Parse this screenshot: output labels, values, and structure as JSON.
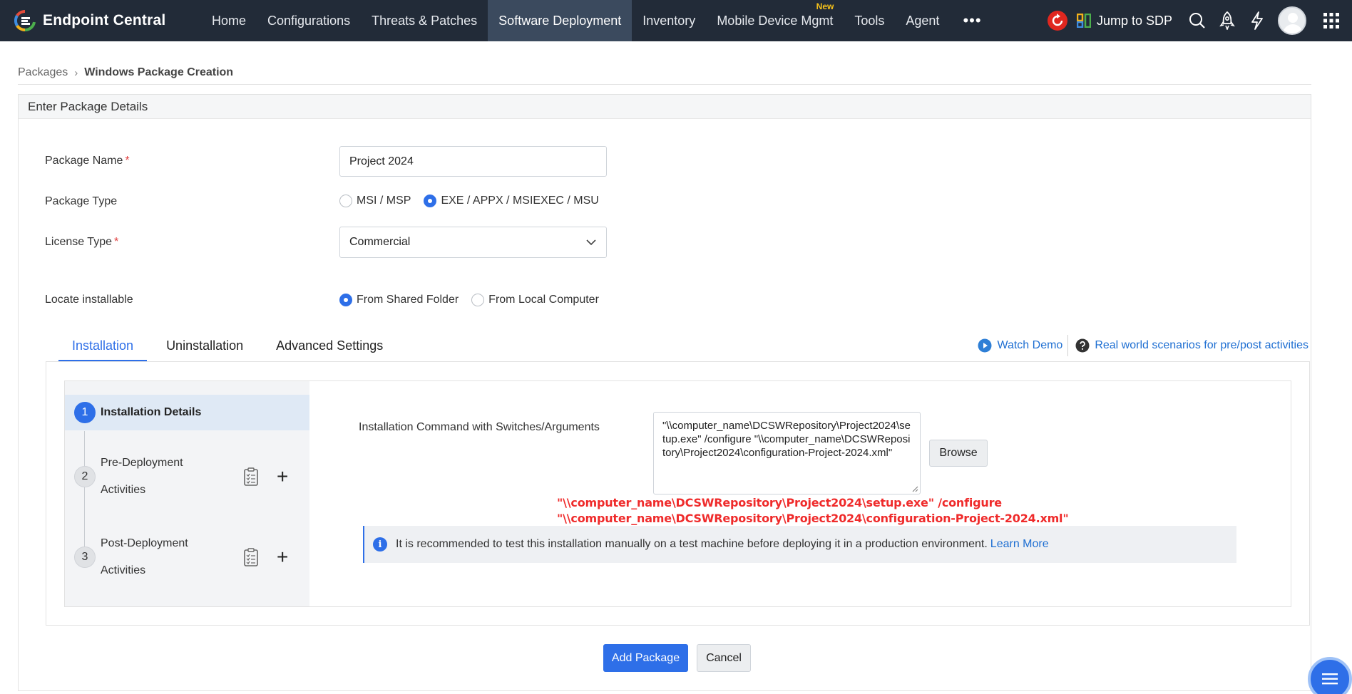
{
  "brand": {
    "name": "Endpoint Central"
  },
  "nav": {
    "items": [
      {
        "label": "Home"
      },
      {
        "label": "Configurations"
      },
      {
        "label": "Threats & Patches"
      },
      {
        "label": "Software Deployment"
      },
      {
        "label": "Inventory"
      },
      {
        "label": "Mobile Device Mgmt",
        "badge": "New"
      },
      {
        "label": "Tools"
      },
      {
        "label": "Agent"
      }
    ],
    "more_label": "•••",
    "active_index": 3,
    "jump_label": "Jump to SDP",
    "icons": [
      "refresh-icon",
      "sdp-icon",
      "search-icon",
      "rocket-icon",
      "lightning-icon",
      "avatar",
      "app-grid-icon"
    ]
  },
  "breadcrumb": {
    "parent": "Packages",
    "separator": "›",
    "current": "Windows Package Creation"
  },
  "panel": {
    "title": "Enter Package Details"
  },
  "form": {
    "package_name": {
      "label": "Package Name",
      "value": "Project 2024"
    },
    "package_type": {
      "label": "Package Type",
      "options": [
        {
          "label": "MSI / MSP",
          "selected": false
        },
        {
          "label": "EXE / APPX / MSIEXEC / MSU",
          "selected": true
        }
      ]
    },
    "license_type": {
      "label": "License Type",
      "value": "Commercial"
    },
    "locate": {
      "label": "Locate installable",
      "options": [
        {
          "label": "From Shared Folder",
          "selected": true
        },
        {
          "label": "From Local Computer",
          "selected": false
        }
      ]
    },
    "required_marker": "*"
  },
  "tabs": [
    {
      "label": "Installation",
      "active": true
    },
    {
      "label": "Uninstallation",
      "active": false
    },
    {
      "label": "Advanced Settings",
      "active": false
    }
  ],
  "help": {
    "watch_demo": "Watch Demo",
    "scenarios": "Real world scenarios for pre/post activities"
  },
  "steps": [
    {
      "num": "1",
      "label": "Installation Details"
    },
    {
      "num": "2",
      "label": "Pre-Deployment Activities"
    },
    {
      "num": "3",
      "label": "Post-Deployment Activities"
    }
  ],
  "installation": {
    "command_label": "Installation Command with Switches/Arguments",
    "command_value": "\"\\\\computer_name\\DCSWRepository\\Project2024\\setup.exe\" /configure \"\\\\computer_name\\DCSWRepository\\Project2024\\configuration-Project-2024.xml\"",
    "browse_label": "Browse",
    "annotation_line1": "\"\\\\computer_name\\DCSWRepository\\Project2024\\setup.exe\" /configure",
    "annotation_line2": "\"\\\\computer_name\\DCSWRepository\\Project2024\\configuration-Project-2024.xml\"",
    "info_text": "It is recommended to test this installation manually on a test machine before deploying it in a production environment.",
    "info_link": "Learn More"
  },
  "footer": {
    "add_label": "Add Package",
    "cancel_label": "Cancel"
  },
  "colors": {
    "nav_bg": "#222b38",
    "nav_active": "#3b4a5e",
    "accent": "#2e6fe8",
    "link": "#1f6fd2",
    "required": "#e03d3d",
    "annotation": "#ef2b2b",
    "new_badge": "#f7c21a"
  }
}
